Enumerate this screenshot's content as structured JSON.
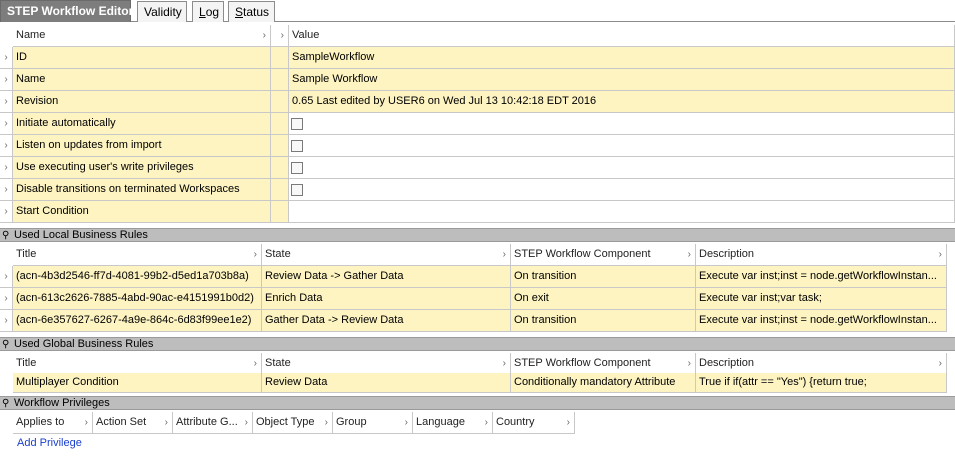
{
  "tabs": [
    {
      "label": "STEP Workflow Editor"
    },
    {
      "label": "Validity"
    },
    {
      "label_pre": "",
      "label_ul": "L",
      "label_post": "og"
    },
    {
      "label_pre": "",
      "label_ul": "S",
      "label_post": "tatus"
    }
  ],
  "properties": {
    "header": {
      "name": "Name",
      "value": "Value"
    },
    "rows": [
      {
        "name": "ID",
        "value": "SampleWorkflow"
      },
      {
        "name": "Name",
        "value": "Sample Workflow"
      },
      {
        "name": "Revision",
        "value": "0.65 Last edited by USER6 on Wed Jul 13 10:42:18 EDT 2016"
      },
      {
        "name": "Initiate automatically"
      },
      {
        "name": "Listen on updates from import"
      },
      {
        "name": "Use executing user's write privileges"
      },
      {
        "name": "Disable transitions on terminated Workspaces"
      },
      {
        "name": "Start Condition",
        "value": ""
      }
    ]
  },
  "local_rules": {
    "title": "Used Local Business Rules",
    "columns": [
      "Title",
      "State",
      "STEP Workflow Component",
      "Description"
    ],
    "rows": [
      [
        "(acn-4b3d2546-ff7d-4081-99b2-d5ed1a703b8a)",
        "Review Data -> Gather Data",
        "On transition",
        "Execute var inst;inst = node.getWorkflowInstan..."
      ],
      [
        "(acn-613c2626-7885-4abd-90ac-e4151991b0d2)",
        "Enrich Data",
        "On exit",
        "Execute var inst;var task;"
      ],
      [
        "(acn-6e357627-6267-4a9e-864c-6d83f99ee1e2)",
        "Gather Data -> Review Data",
        "On transition",
        "Execute var inst;inst = node.getWorkflowInstan..."
      ]
    ]
  },
  "global_rules": {
    "title": "Used Global Business Rules",
    "columns": [
      "Title",
      "State",
      "STEP Workflow Component",
      "Description"
    ],
    "rows": [
      [
        "Multiplayer Condition",
        "Review Data",
        "Conditionally mandatory Attribute",
        "True if if(attr == \"Yes\") {return true;"
      ]
    ]
  },
  "privileges": {
    "title": "Workflow Privileges",
    "columns": [
      "Applies to",
      "Action Set",
      "Attribute G...",
      "Object Type",
      "Group",
      "Language",
      "Country"
    ],
    "add_link": "Add Privilege"
  },
  "glyphs": {
    "expander": "›",
    "header_arrow": "›",
    "pin": "⚲"
  }
}
